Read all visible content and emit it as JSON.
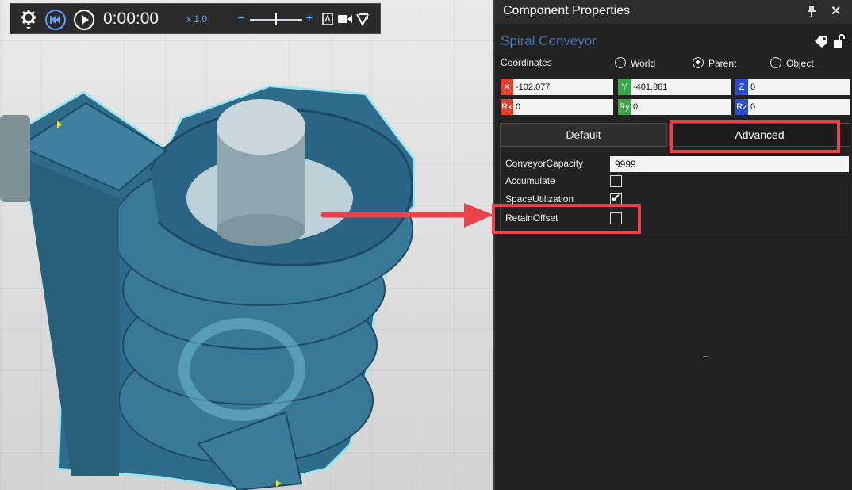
{
  "toolbar": {
    "time": "0:00:00",
    "speed": "x 1.0",
    "minus": "−",
    "plus": "+"
  },
  "panel": {
    "title": "Component Properties",
    "pin_icon": "pin-icon",
    "close_icon": "close-icon",
    "component_name": "Spiral Conveyor",
    "coordinates_label": "Coordinates",
    "coord_options": [
      {
        "label": "World",
        "selected": false
      },
      {
        "label": "Parent",
        "selected": true
      },
      {
        "label": "Object",
        "selected": false
      }
    ],
    "coords": [
      {
        "tag": "X",
        "value": "-102.077",
        "color": "#e8402a"
      },
      {
        "tag": "Y",
        "value": "-401.881",
        "color": "#3aa84a"
      },
      {
        "tag": "Z",
        "value": "0",
        "color": "#2a4bd8"
      },
      {
        "tag": "Rx",
        "value": "0",
        "color": "#e8402a"
      },
      {
        "tag": "Ry",
        "value": "0",
        "color": "#3aa84a"
      },
      {
        "tag": "Rz",
        "value": "0",
        "color": "#2a4bd8"
      }
    ],
    "tabs": [
      {
        "label": "Default",
        "active": false
      },
      {
        "label": "Advanced",
        "active": true
      }
    ],
    "properties": [
      {
        "label": "ConveyorCapacity",
        "type": "text",
        "value": "9999"
      },
      {
        "label": "Accumulate",
        "type": "checkbox",
        "checked": false
      },
      {
        "label": "SpaceUtilization",
        "type": "checkbox",
        "checked": true
      },
      {
        "label": "RetainOffset",
        "type": "checkbox",
        "checked": false
      }
    ]
  },
  "colors": {
    "highlight": "#e8434a",
    "conveyor": "#2e6a8a",
    "selection_glow": "#7fe0f0"
  }
}
